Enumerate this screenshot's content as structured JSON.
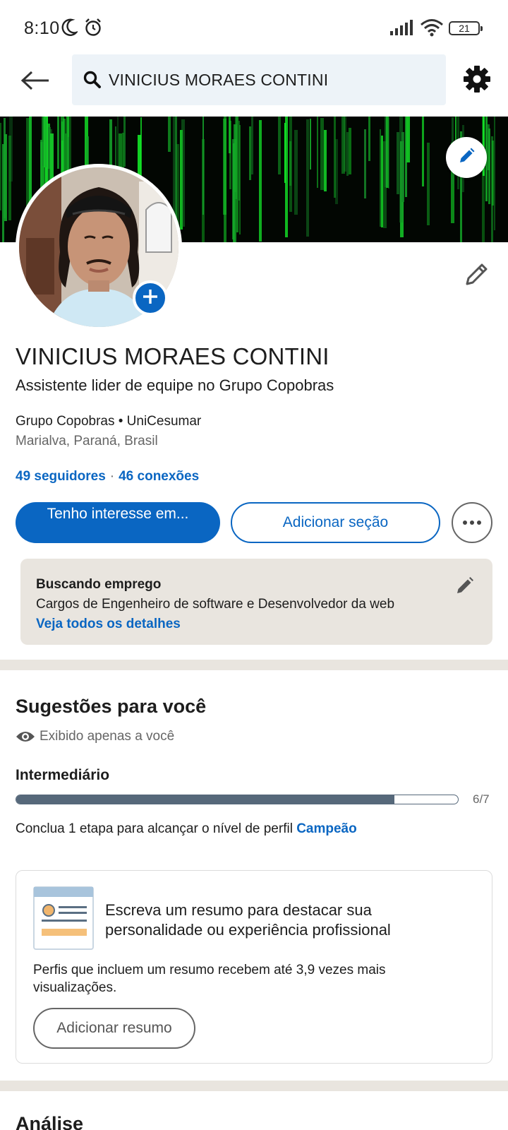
{
  "status_bar": {
    "time": "8:10",
    "battery": "21",
    "icons": [
      "moon-icon",
      "alarm-icon",
      "signal-icon",
      "wifi-icon",
      "battery-icon"
    ]
  },
  "app_bar": {
    "back_icon": "arrow-left-icon",
    "search_text": "VINICIUS MORAES CONTINI",
    "settings_icon": "gear-icon"
  },
  "profile": {
    "name": "VINICIUS MORAES CONTINI",
    "headline": "Assistente lider de equipe no Grupo Copobras",
    "org_line": "Grupo Copobras • UniCesumar",
    "location": "Marialva, Paraná, Brasil",
    "followers": "49 seguidores",
    "separator": "·",
    "connections": "46 conexões"
  },
  "actions": {
    "primary": "Tenho interesse em...",
    "secondary": "Adicionar seção",
    "more_icon": "more-horizontal-icon"
  },
  "open_to_work": {
    "title": "Buscando emprego",
    "description": "Cargos de Engenheiro de software e Desenvolvedor da web",
    "link": "Veja todos os detalhes"
  },
  "suggestions": {
    "title": "Sugestões para você",
    "private_note": "Exibido apenas a você",
    "level": "Intermediário",
    "progress_count": "6/7",
    "progress_fraction": 0.857,
    "note_prefix": "Conclua 1 etapa para alcançar o nível de perfil",
    "note_target": "Campeão",
    "card": {
      "title": "Escreva um resumo para destacar sua personalidade ou experiência profissional",
      "description": "Perfis que incluem um resumo recebem até 3,9 vezes mais visualizações.",
      "button": "Adicionar resumo"
    }
  },
  "next_section": {
    "title": "Análise"
  },
  "colors": {
    "brand_blue": "#0a66c2",
    "search_bg": "#edf3f8",
    "card_beige": "#e9e5df",
    "progress_gray": "#56687a"
  }
}
